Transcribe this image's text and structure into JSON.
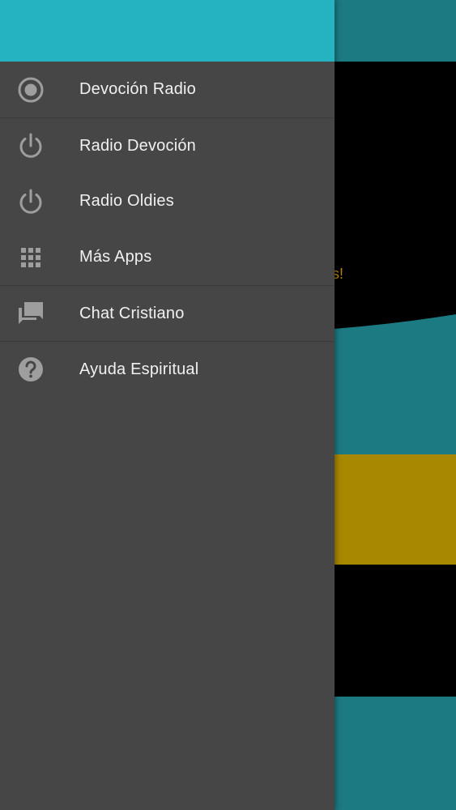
{
  "drawer": {
    "items": [
      {
        "label": "Devoción Radio",
        "icon": "radio-button-icon"
      },
      {
        "label": "Radio Devoción",
        "icon": "power-icon"
      },
      {
        "label": "Radio Oldies",
        "icon": "power-icon"
      },
      {
        "label": "Más Apps",
        "icon": "apps-grid-icon"
      },
      {
        "label": "Chat Cristiano",
        "icon": "chat-icon"
      },
      {
        "label": "Ayuda Espiritual",
        "icon": "help-icon"
      }
    ]
  },
  "background": {
    "partial_text": "as!"
  },
  "colors": {
    "drawer_header": "#26b3c1",
    "drawer_bg": "#464646",
    "app_teal": "#1b7a82",
    "app_gold": "#a88800",
    "icon_gray": "#9e9e9e"
  }
}
